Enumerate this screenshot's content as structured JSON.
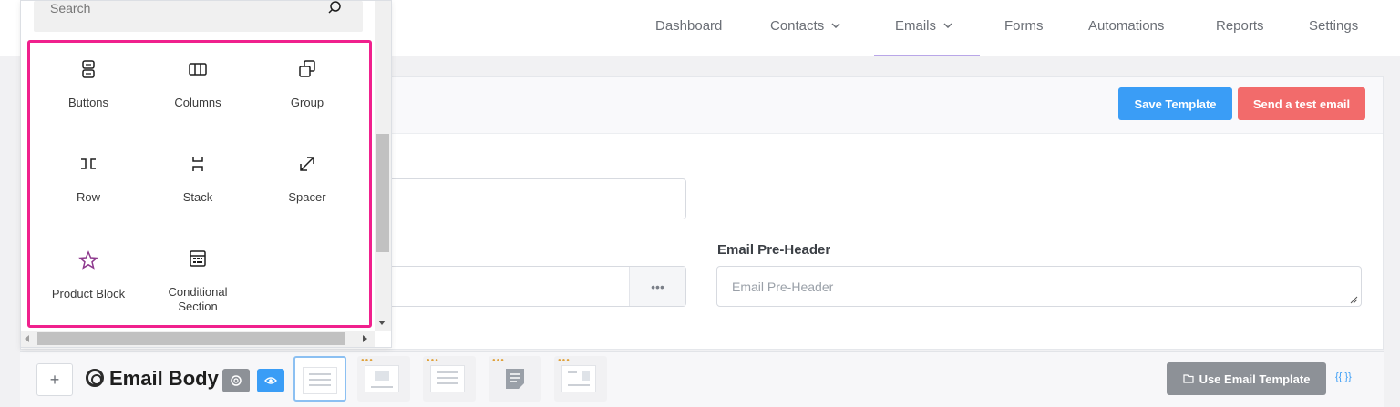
{
  "nav": {
    "items": [
      {
        "label": "Dashboard"
      },
      {
        "label": "Contacts",
        "dropdown": true
      },
      {
        "label": "Emails",
        "dropdown": true,
        "active": true
      },
      {
        "label": "Forms"
      },
      {
        "label": "Automations"
      },
      {
        "label": "Reports"
      },
      {
        "label": "Settings"
      }
    ]
  },
  "header": {
    "save_label": "Save Template",
    "test_label": "Send a test email"
  },
  "form": {
    "preheader_label": "Email Pre-Header",
    "preheader_placeholder": "Email Pre-Header",
    "from_more": "•••"
  },
  "inserter": {
    "search_placeholder": "Search",
    "blocks": [
      {
        "label": "Buttons",
        "icon": "buttons-icon"
      },
      {
        "label": "Columns",
        "icon": "columns-icon"
      },
      {
        "label": "Group",
        "icon": "group-icon"
      },
      {
        "label": "Row",
        "icon": "row-icon"
      },
      {
        "label": "Stack",
        "icon": "stack-icon"
      },
      {
        "label": "Spacer",
        "icon": "spacer-icon"
      },
      {
        "label": "Product Block",
        "icon": "star-icon"
      },
      {
        "label": "Conditional Section",
        "icon": "conditional-icon"
      }
    ]
  },
  "footer": {
    "title": "Email Body",
    "use_template_label": "Use Email Template",
    "smartcodes": "{{ }}"
  },
  "colors": {
    "primary": "#3a9df6",
    "danger": "#f26b6b",
    "highlight": "#f0208d",
    "star": "#8e3a8e"
  }
}
